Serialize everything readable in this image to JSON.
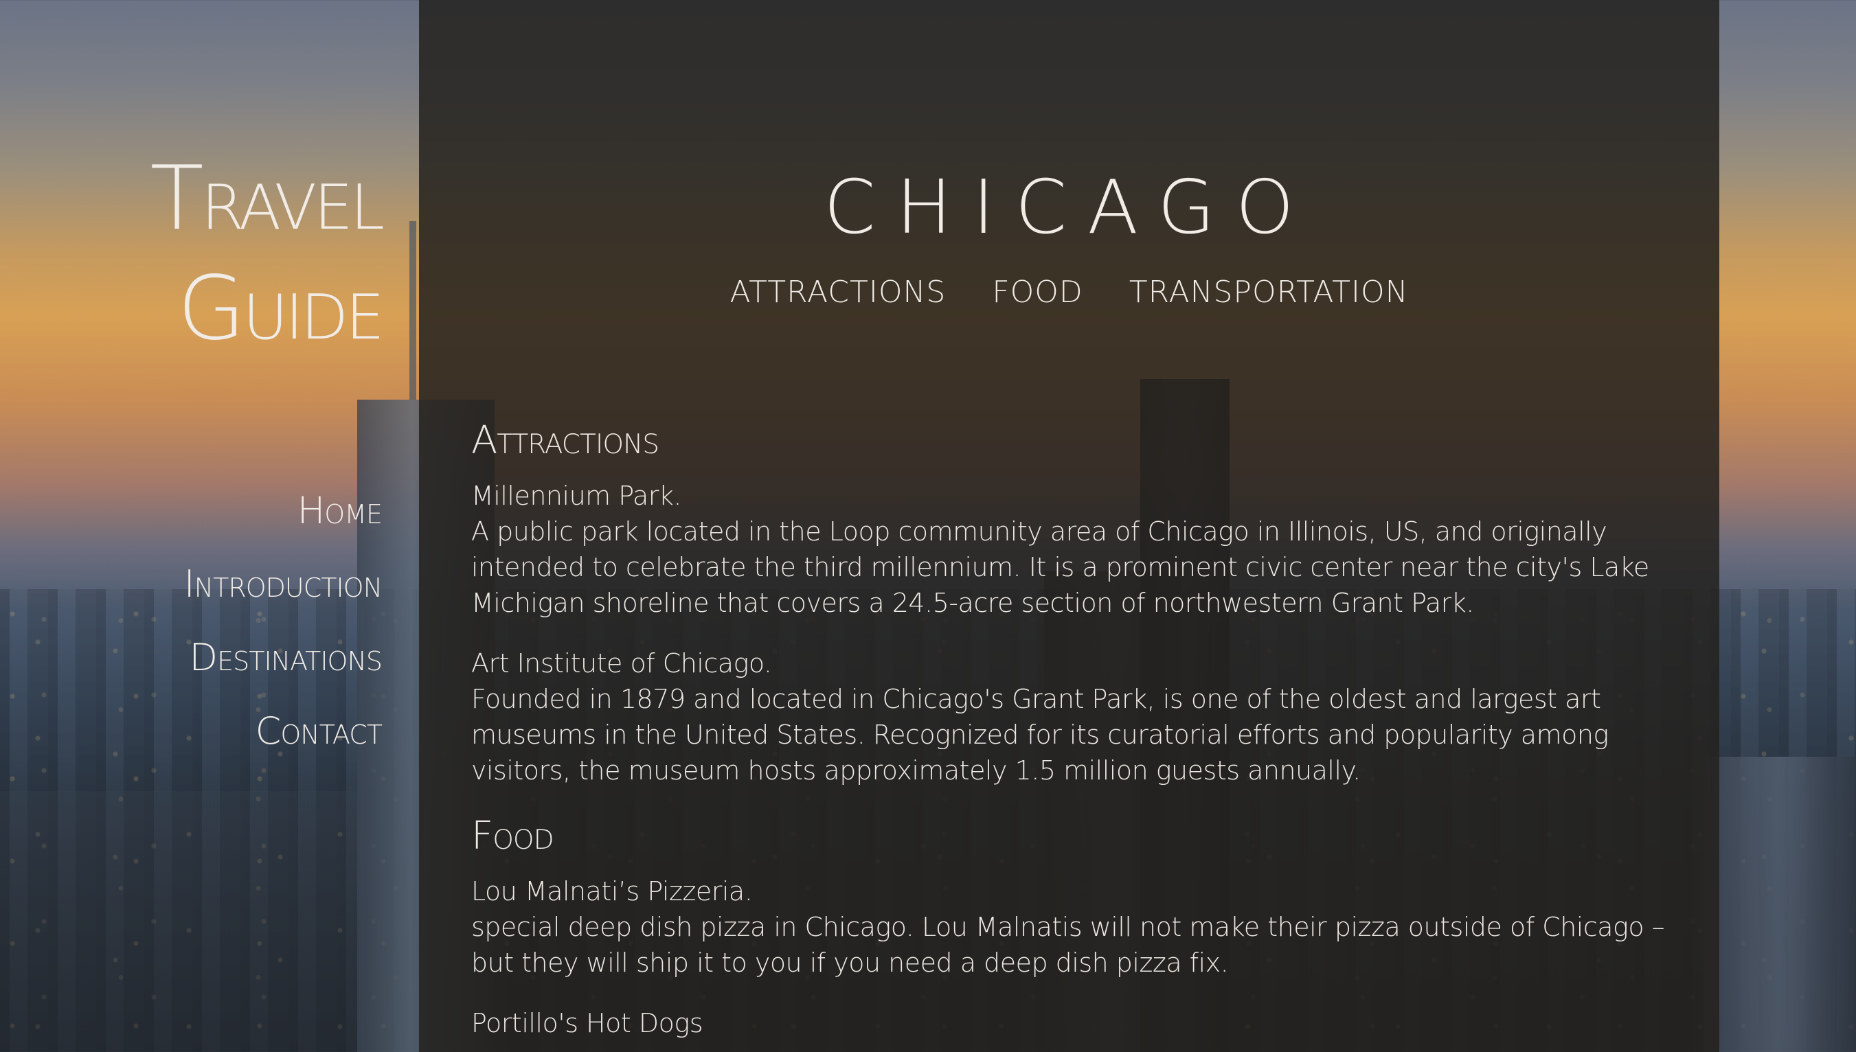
{
  "sidebar": {
    "logo_line1": "Travel",
    "logo_line2": "Guide",
    "nav": [
      {
        "label": "Home"
      },
      {
        "label": "Introduction"
      },
      {
        "label": "Destinations"
      },
      {
        "label": "Contact"
      }
    ]
  },
  "header": {
    "title": "CHICAGO",
    "nav": [
      {
        "label": "ATTRACTIONS"
      },
      {
        "label": "FOOD"
      },
      {
        "label": "TRANSPORTATION"
      }
    ]
  },
  "sections": {
    "attractions": {
      "title": "Attractions",
      "items": [
        {
          "name": "Millennium Park.",
          "desc": "A public park located in the Loop community area of Chicago in Illinois, US, and originally intended to celebrate the third millennium. It is a prominent civic center near the city's Lake Michigan shoreline that covers a 24.5-acre section of northwestern Grant Park."
        },
        {
          "name": "Art Institute of Chicago.",
          "desc": "Founded in 1879 and located in Chicago's Grant Park, is one of the oldest and largest art museums in the United States. Recognized for its curatorial efforts and popularity among visitors, the museum hosts approximately 1.5 million guests annually."
        }
      ]
    },
    "food": {
      "title": "Food",
      "items": [
        {
          "name": "Lou Malnati’s Pizzeria.",
          "desc": "special deep dish pizza in Chicago. Lou Malnatis will not make their pizza outside of Chicago – but they will ship it to you if you need a deep dish pizza fix."
        },
        {
          "name": "Portillo's Hot Dogs",
          "desc": ""
        }
      ]
    }
  }
}
